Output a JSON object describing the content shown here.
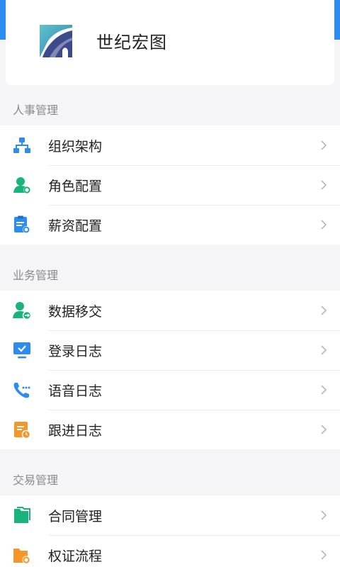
{
  "company": {
    "name": "世纪宏图",
    "logo_icon": "company-logo-icon"
  },
  "sections": [
    {
      "header": "人事管理",
      "items": [
        {
          "label": "组织架构",
          "icon": "org-chart-icon",
          "color": "#2d8cf0"
        },
        {
          "label": "角色配置",
          "icon": "user-settings-icon",
          "color": "#19b37c"
        },
        {
          "label": "薪资配置",
          "icon": "clipboard-settings-icon",
          "color": "#2d8cf0"
        }
      ]
    },
    {
      "header": "业务管理",
      "items": [
        {
          "label": "数据移交",
          "icon": "user-transfer-icon",
          "color": "#19b37c"
        },
        {
          "label": "登录日志",
          "icon": "monitor-check-icon",
          "color": "#2d8cf0"
        },
        {
          "label": "语音日志",
          "icon": "phone-icon",
          "color": "#2d8cf0"
        },
        {
          "label": "跟进日志",
          "icon": "document-clock-icon",
          "color": "#f5962b"
        }
      ]
    },
    {
      "header": "交易管理",
      "items": [
        {
          "label": "合同管理",
          "icon": "folder-icon",
          "color": "#19b37c"
        },
        {
          "label": "权证流程",
          "icon": "folder-settings-icon",
          "color": "#f5962b"
        }
      ]
    }
  ],
  "colors": {
    "accent": "#2d8cf0",
    "green": "#19b37c",
    "orange": "#f5962b",
    "chevron": "#b8b8b8"
  }
}
